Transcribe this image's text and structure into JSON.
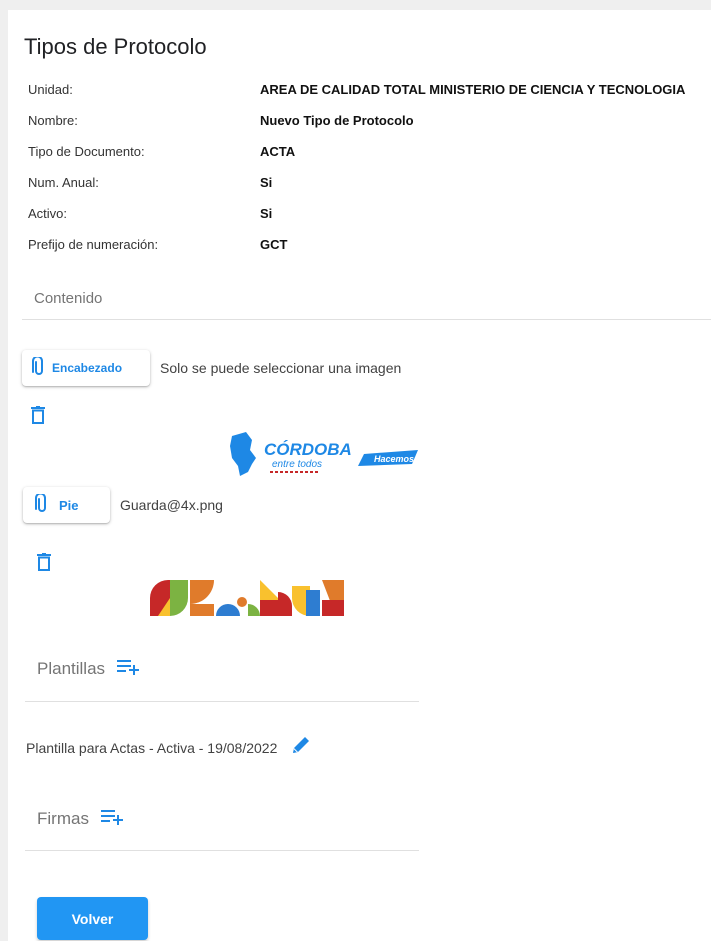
{
  "page_title": "Tipos de Protocolo",
  "fields": [
    {
      "label": "Unidad:",
      "value": "AREA DE CALIDAD TOTAL MINISTERIO DE CIENCIA Y TECNOLOGIA"
    },
    {
      "label": "Nombre:",
      "value": "Nuevo Tipo de Protocolo"
    },
    {
      "label": "Tipo de Documento:",
      "value": "ACTA"
    },
    {
      "label": "Num. Anual:",
      "value": "Si"
    },
    {
      "label": "Activo:",
      "value": "Si"
    },
    {
      "label": "Prefijo de numeración:",
      "value": "GCT"
    }
  ],
  "contenido": {
    "title": "Contenido",
    "header_button_label": "Encabezado",
    "header_hint": "Solo se puede seleccionar una imagen",
    "header_logo": {
      "text": "CÓRDOBA",
      "sub": "entre todos",
      "badge": "Hacemos"
    },
    "footer_button_label": "Pie",
    "footer_filename": "Guarda@4x.png"
  },
  "plantillas": {
    "title": "Plantillas",
    "items": [
      "Plantilla para Actas - Activa - 19/08/2022"
    ]
  },
  "firmas": {
    "title": "Firmas"
  },
  "volver_label": "Volver",
  "colors": {
    "accent": "#1e88e5",
    "primary_button": "#2196f3"
  }
}
